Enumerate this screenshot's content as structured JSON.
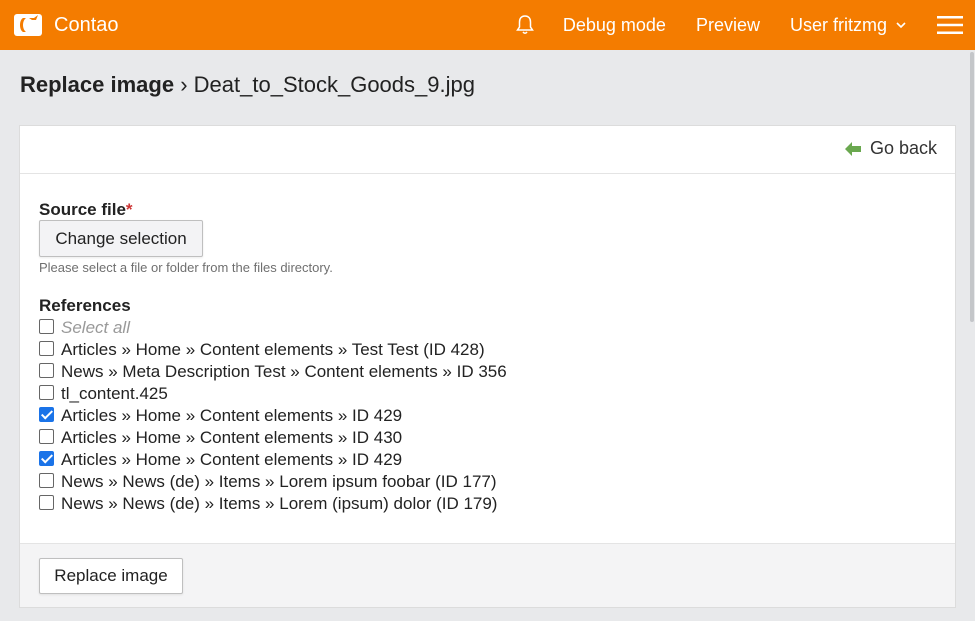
{
  "topbar": {
    "app_name": "Contao",
    "logo_icon": "contao-logo-icon",
    "notifications_icon": "bell-icon",
    "debug_label": "Debug mode",
    "preview_label": "Preview",
    "user_label": "User fritzmg",
    "user_chevron_icon": "chevron-down-icon",
    "menu_icon": "hamburger-menu-icon",
    "color": "#f47c00"
  },
  "page": {
    "title_main": "Replace image",
    "title_separator": "›",
    "title_file": "Deat_to_Stock_Goods_9.jpg"
  },
  "header": {
    "go_back_label": "Go back",
    "go_back_icon": "arrow-left-icon"
  },
  "form": {
    "source_label": "Source file",
    "required_mark": "*",
    "change_selection_label": "Change selection",
    "help_text": "Please select a file or folder from the files directory.",
    "references_label": "References",
    "select_all_label": "Select all",
    "references": [
      {
        "label": "Articles » Home » Content elements » Test Test (ID 428)",
        "checked": false
      },
      {
        "label": "News » Meta Description Test » Content elements » ID 356",
        "checked": false
      },
      {
        "label": "tl_content.425",
        "checked": false
      },
      {
        "label": "Articles » Home » Content elements » ID 429",
        "checked": true
      },
      {
        "label": "Articles » Home » Content elements » ID 430",
        "checked": false
      },
      {
        "label": "Articles » Home » Content elements » ID 429",
        "checked": true
      },
      {
        "label": "News » News (de) » Items » Lorem ipsum foobar (ID 177)",
        "checked": false
      },
      {
        "label": "News » News (de) » Items » Lorem (ipsum) dolor (ID 179)",
        "checked": false
      }
    ],
    "submit_label": "Replace image"
  }
}
